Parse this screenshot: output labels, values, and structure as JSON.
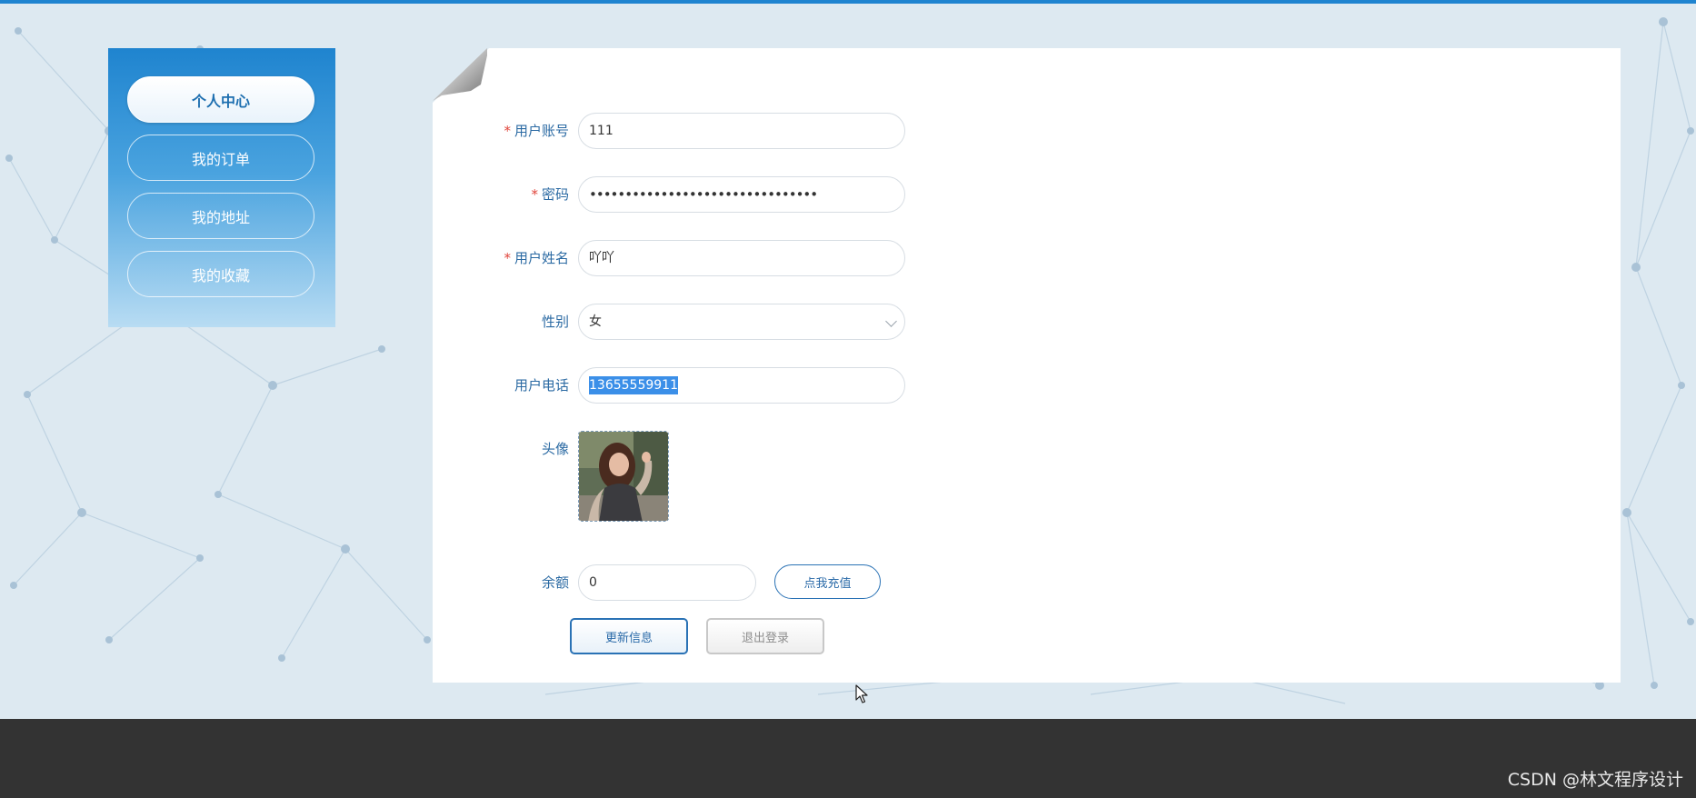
{
  "sidebar": {
    "items": [
      {
        "label": "个人中心",
        "active": true
      },
      {
        "label": "我的订单",
        "active": false
      },
      {
        "label": "我的地址",
        "active": false
      },
      {
        "label": "我的收藏",
        "active": false
      }
    ]
  },
  "form": {
    "account_label": "用户账号",
    "account_value": "111",
    "password_label": "密码",
    "password_value": "••••••••••••••••••••••••••••••••",
    "name_label": "用户姓名",
    "name_value": "吖吖",
    "gender_label": "性别",
    "gender_value": "女",
    "phone_label": "用户电话",
    "phone_value": "13655559911",
    "avatar_label": "头像",
    "balance_label": "余额",
    "balance_value": "0",
    "required_mark": "*"
  },
  "buttons": {
    "recharge": "点我充值",
    "update": "更新信息",
    "logout": "退出登录"
  },
  "footer": {
    "watermark": "CSDN @林文程序设计"
  },
  "colors": {
    "accent": "#1f84d0",
    "label": "#2b6aa3",
    "required": "#e0453b",
    "selection": "#3b8fe8",
    "footer": "#333333"
  }
}
